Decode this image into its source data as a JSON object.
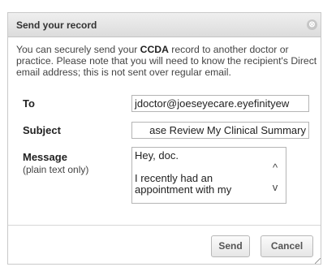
{
  "dialog": {
    "title": "Send your record",
    "close_glyph": "⊗",
    "intro": {
      "part1": "You can securely send your ",
      "bold": "CCDA",
      "part2": " record to another doctor or practice. Please note that you will need to know the recipient's Direct email address; this is not sent over regular email."
    },
    "fields": {
      "to_label": "To",
      "to_value": "jdoctor@joeseyecare.eyefinityew",
      "subject_label": "Subject",
      "subject_value": "ase Review My Clinical Summary",
      "message_label": "Message",
      "message_sublabel": "(plain text only)",
      "message_value": "Hey, doc.\n\nI recently had an appointment with my"
    },
    "buttons": {
      "send": "Send",
      "cancel": "Cancel"
    },
    "scroll_up_glyph": "^",
    "scroll_down_glyph": "v"
  },
  "colors": {
    "titlebar": "#e4e4e4",
    "border": "#c9c9c9",
    "text": "#444444"
  },
  "icons": [
    "close-icon",
    "chevron-up-icon",
    "chevron-down-icon",
    "resize-grip-icon"
  ]
}
